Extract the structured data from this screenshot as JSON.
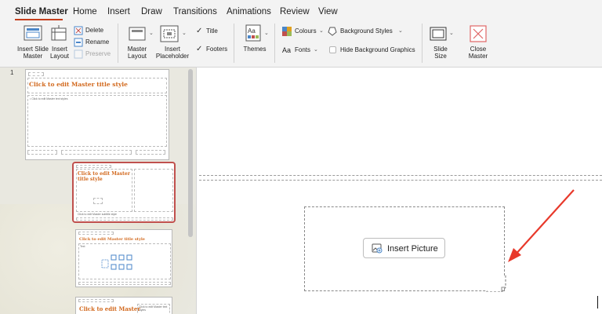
{
  "tabs": [
    {
      "label": "Slide Master",
      "active": true
    },
    {
      "label": "Home",
      "active": false
    },
    {
      "label": "Insert",
      "active": false
    },
    {
      "label": "Draw",
      "active": false
    },
    {
      "label": "Transitions",
      "active": false
    },
    {
      "label": "Animations",
      "active": false
    },
    {
      "label": "Review",
      "active": false
    },
    {
      "label": "View",
      "active": false
    }
  ],
  "ribbon": {
    "insert_slide_master": "Insert Slide\nMaster",
    "insert_layout": "Insert\nLayout",
    "delete": "Delete",
    "rename": "Rename",
    "preserve": "Preserve",
    "master_layout": "Master\nLayout",
    "insert_placeholder": "Insert\nPlaceholder",
    "title_check": "Title",
    "footers_check": "Footers",
    "themes": "Themes",
    "colours": "Colours",
    "background_styles": "Background Styles",
    "fonts": "Fonts",
    "hide_background_graphics": "Hide Background Graphics",
    "slide_size": "Slide\nSize",
    "close_master": "Close\nMaster"
  },
  "thumbnails": {
    "slide_number": "1",
    "master_title": "Click to edit Master title style",
    "master_text": "• Click to edit Master text styles",
    "layout2_title": "Click to edit Master title style",
    "layout2_text": "Click to edit Master subtitle style",
    "layout3_title": "Click to edit Master title style",
    "layout3_text": "Text",
    "layout4_title": "Click to edit Master",
    "layout4_text": "Click to edit Master text styles"
  },
  "canvas": {
    "insert_picture_label": "Insert Picture"
  },
  "colors": {
    "accent": "#c43e1c",
    "title_orange": "#d2691e",
    "selection": "#c0504d",
    "arrow": "#e8392b",
    "close_master_icon": "#e06666"
  },
  "icons": [
    "insert-slide-master-icon",
    "insert-layout-icon",
    "delete-icon",
    "rename-icon",
    "preserve-icon",
    "master-layout-icon",
    "insert-placeholder-icon",
    "themes-icon",
    "colours-icon",
    "background-styles-icon",
    "slide-size-icon",
    "close-master-icon",
    "picture-icon"
  ]
}
